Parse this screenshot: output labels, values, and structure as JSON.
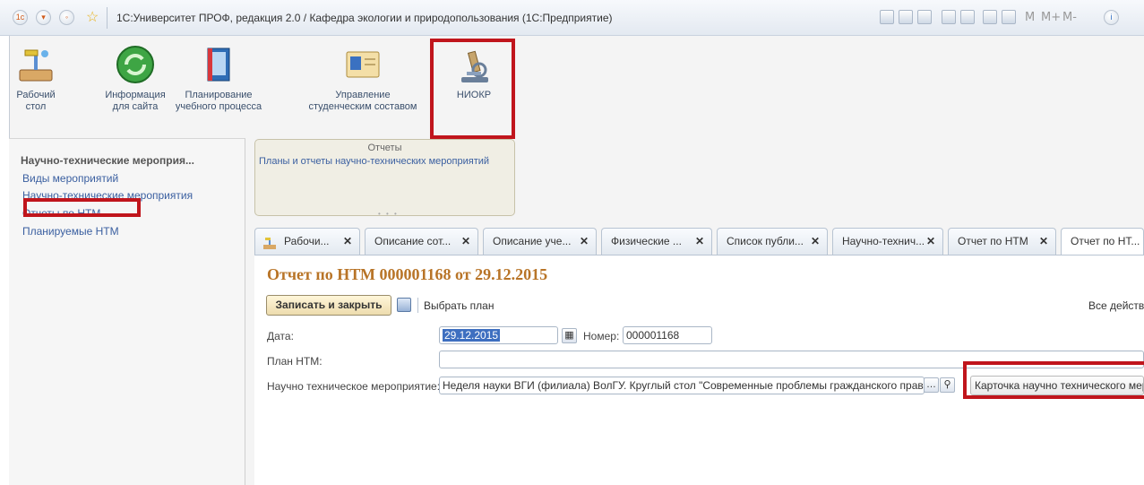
{
  "window": {
    "title": "1С:Университет ПРОФ, редакция 2.0 / Кафедра экологии и природопользования  (1С:Предприятие)",
    "toolbar_text": [
      "M",
      "M+",
      "M-"
    ]
  },
  "sections": [
    {
      "label1": "Рабочий",
      "label2": "стол",
      "icon": "desk-lamp-icon"
    },
    {
      "label1": "Информация",
      "label2": "для сайта",
      "icon": "refresh-globe-icon"
    },
    {
      "label1": "Планирование",
      "label2": "учебного процесса",
      "icon": "book-icon"
    },
    {
      "label1": "Управление",
      "label2": "студенческим составом",
      "icon": "id-card-icon"
    },
    {
      "label1": "НИОКР",
      "label2": "",
      "icon": "microscope-icon"
    }
  ],
  "left_nav": {
    "title": "Научно-технические мероприя...",
    "items": [
      "Виды мероприятий",
      "Научно-технические мероприятия",
      "Отчеты по НТМ",
      "Планируемые НТМ"
    ]
  },
  "reports": {
    "header": "Отчеты",
    "item": "Планы и отчеты научно-технических мероприятий"
  },
  "tabs": [
    "Рабочи...",
    "Описание сот...",
    "Описание уче...",
    "Физические ...",
    "Список публи...",
    "Научно-технич...",
    "Отчет по НТМ",
    "Отчет по НТ..."
  ],
  "document": {
    "title": "Отчет по НТМ 000001168 от 29.12.2015",
    "save_close_label": "Записать и закрыть",
    "choose_plan_label": "Выбрать план",
    "all_actions_label": "Все действ",
    "date_label": "Дата:",
    "date_value": "29.12.2015",
    "number_label": "Номер:",
    "number_value": "000001168",
    "plan_label": "План НТМ:",
    "plan_value": "",
    "event_label": "Научно техническое мероприятие:",
    "event_value": "Неделя науки ВГИ (филиала) ВолГУ. Круглый стол \"Современные проблемы гражданского права,",
    "card_button": "Карточка научно технического меро"
  },
  "highlight_color": "#c0151c"
}
